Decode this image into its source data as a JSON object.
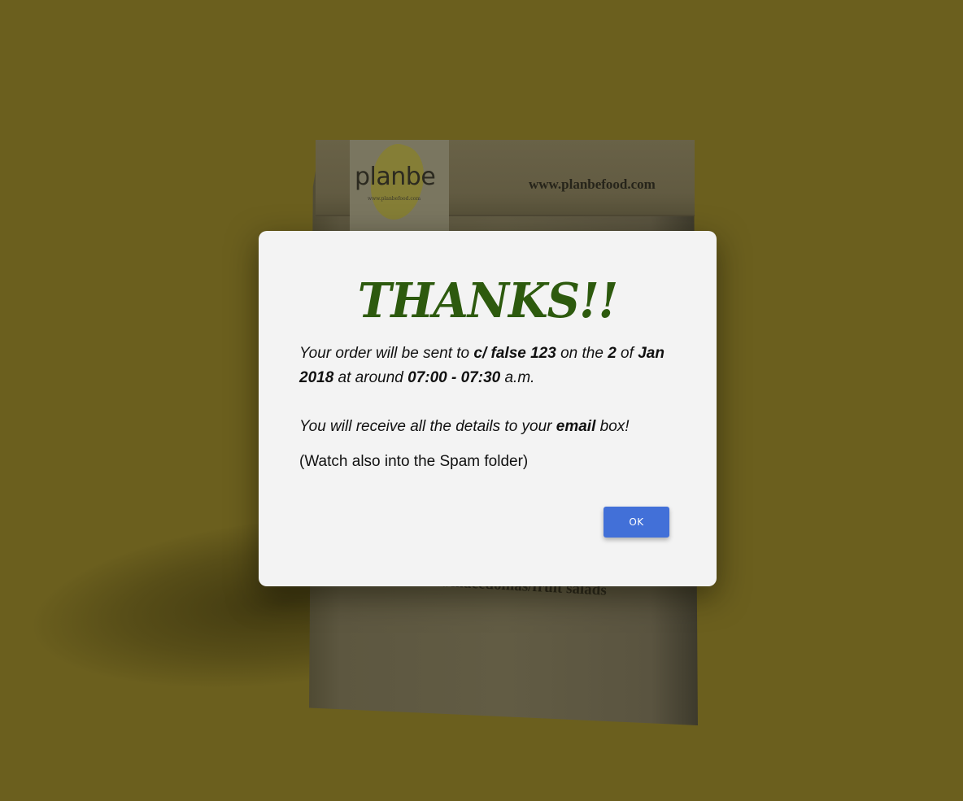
{
  "background": {
    "bag_logo": "planbe",
    "bag_logo_url": "www.planbefood.com",
    "bag_url": "www.planbefood.com",
    "bag_caption": "…/macedonias/fruit salads",
    "overlay_color": "#6b5f1e"
  },
  "dialog": {
    "title": "THANKS!!",
    "title_color": "#2d5a0e",
    "order_line": {
      "prefix": "Your order will be sent to ",
      "address": "c/ false 123",
      "on_the": " on the ",
      "day": "2",
      "of": " of ",
      "month_year": "Jan 2018",
      "at_around": " at around ",
      "time_range": "07:00 - 07:30",
      "suffix": " a.m."
    },
    "details_line": {
      "prefix": "You will receive all the details to your ",
      "emphasis": "email",
      "suffix": " box!"
    },
    "spam_note": "(Watch also into the Spam folder)",
    "ok_label": "OK",
    "ok_color": "#4270d8"
  }
}
